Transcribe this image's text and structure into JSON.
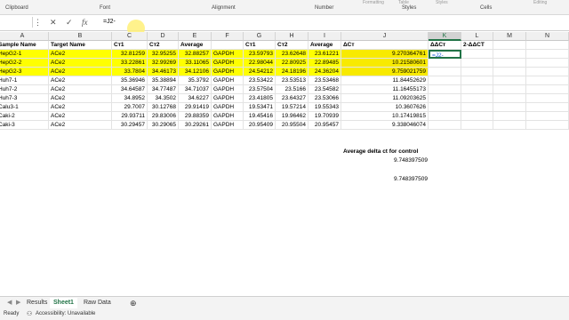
{
  "ribbon": {
    "groups": [
      "Clipboard",
      "Font",
      "Alignment",
      "Number",
      "Styles",
      "Cells"
    ],
    "sub_labels": [
      "Formatting",
      "Table",
      "Styles",
      "Editing"
    ]
  },
  "formula_bar": {
    "cancel": "✕",
    "enter": "✓",
    "fx": "fx",
    "content": "=J2-"
  },
  "columns": [
    "A",
    "B",
    "C",
    "D",
    "E",
    "F",
    "G",
    "H",
    "I",
    "J",
    "K",
    "L",
    "M",
    "N"
  ],
  "selected_column": "K",
  "rows": [
    {
      "A": "Sample Name",
      "B": "Target Name",
      "C": "Cт1",
      "D": "Cт2",
      "E": "Average",
      "F": "",
      "G": "Cт1",
      "H": "Cт2",
      "I": "Average",
      "J": "ΔCт",
      "K": "ΔΔCт",
      "L": "2-ΔΔCT",
      "bold": true
    },
    {
      "A": "HepG2-1",
      "B": "ACe2",
      "C": "32.81259",
      "D": "32.95255",
      "E": "32.88257",
      "F": "GAPDH",
      "G": "23.59793",
      "H": "23.62648",
      "I": "23.61221",
      "J": "9.270364761",
      "K": "=J2-",
      "L": "",
      "hl": true
    },
    {
      "A": "HepG2-2",
      "B": "ACe2",
      "C": "33.22861",
      "D": "32.99269",
      "E": "33.11065",
      "F": "GAPDH",
      "G": "22.98044",
      "H": "22.80925",
      "I": "22.89485",
      "J": "10.21580601",
      "K": "",
      "L": "",
      "hl": true
    },
    {
      "A": "HepG2-3",
      "B": "ACe2",
      "C": "33.7804",
      "D": "34.46173",
      "E": "34.12106",
      "F": "GAPDH",
      "G": "24.54212",
      "H": "24.18196",
      "I": "24.36204",
      "J": "9.759021759",
      "K": "",
      "L": "",
      "hl": true
    },
    {
      "A": "Huh7-1",
      "B": "ACe2",
      "C": "35.36946",
      "D": "35.38894",
      "E": "35.3792",
      "F": "GAPDH",
      "G": "23.53422",
      "H": "23.53513",
      "I": "23.53468",
      "J": "11.84452629",
      "K": "",
      "L": ""
    },
    {
      "A": "Huh7-2",
      "B": "ACe2",
      "C": "34.64587",
      "D": "34.77487",
      "E": "34.71037",
      "F": "GAPDH",
      "G": "23.57504",
      "H": "23.5166",
      "I": "23.54582",
      "J": "11.16455173",
      "K": "",
      "L": ""
    },
    {
      "A": "Huh7-3",
      "B": "ACe2",
      "C": "34.8952",
      "D": "34.3502",
      "E": "34.6227",
      "F": "GAPDH",
      "G": "23.41805",
      "H": "23.64327",
      "I": "23.53066",
      "J": "11.09203625",
      "K": "",
      "L": ""
    },
    {
      "A": "Calu3-1",
      "B": "ACe2",
      "C": "29.7007",
      "D": "30.12768",
      "E": "29.91419",
      "F": "GAPDH",
      "G": "19.53471",
      "H": "19.57214",
      "I": "19.55343",
      "J": "10.3607626",
      "K": "",
      "L": ""
    },
    {
      "A": "Caki-2",
      "B": "ACe2",
      "C": "29.93711",
      "D": "29.83006",
      "E": "29.88359",
      "F": "GAPDH",
      "G": "19.45416",
      "H": "19.96462",
      "I": "19.70939",
      "J": "10.17419815",
      "K": "",
      "L": ""
    },
    {
      "A": "Caki-3",
      "B": "ACe2",
      "C": "30.29457",
      "D": "30.29065",
      "E": "30.29261",
      "F": "GAPDH",
      "G": "20.95409",
      "H": "20.95504",
      "I": "20.95457",
      "J": "9.338046074",
      "K": "",
      "L": ""
    }
  ],
  "notes": {
    "label": "Average delta ct for control",
    "value1": "9.748397509",
    "value2": "9.748397509"
  },
  "sheets": [
    "Results",
    "Sheet1",
    "Raw Data"
  ],
  "active_sheet": "Sheet1",
  "status": {
    "ready": "Ready",
    "accessibility": "Accessibility: Unavailable"
  }
}
